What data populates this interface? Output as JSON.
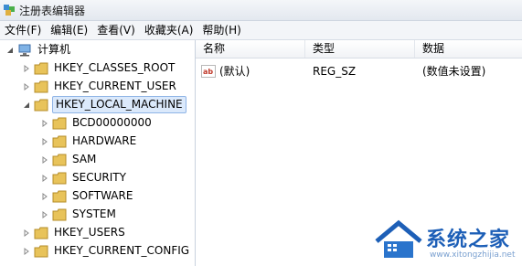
{
  "window": {
    "title": "注册表编辑器"
  },
  "menu": [
    {
      "label": "文件(F)"
    },
    {
      "label": "编辑(E)"
    },
    {
      "label": "查看(V)"
    },
    {
      "label": "收藏夹(A)"
    },
    {
      "label": "帮助(H)"
    }
  ],
  "tree": {
    "root": "计算机",
    "nodes": [
      {
        "label": "HKEY_CLASSES_ROOT",
        "expanded": false
      },
      {
        "label": "HKEY_CURRENT_USER",
        "expanded": false
      },
      {
        "label": "HKEY_LOCAL_MACHINE",
        "expanded": true,
        "selected": true,
        "children": [
          {
            "label": "BCD00000000"
          },
          {
            "label": "HARDWARE"
          },
          {
            "label": "SAM"
          },
          {
            "label": "SECURITY"
          },
          {
            "label": "SOFTWARE"
          },
          {
            "label": "SYSTEM"
          }
        ]
      },
      {
        "label": "HKEY_USERS",
        "expanded": false
      },
      {
        "label": "HKEY_CURRENT_CONFIG",
        "expanded": false
      }
    ]
  },
  "list": {
    "columns": [
      "名称",
      "类型",
      "数据"
    ],
    "rows": [
      {
        "name": "(默认)",
        "type": "REG_SZ",
        "data": "(数值未设置)"
      }
    ]
  },
  "watermark": {
    "text": "系统之家",
    "url": "www.xitongzhijia.net"
  },
  "colors": {
    "selection_bg": "#dbe9fb",
    "folder": "#e8c35a",
    "watermark": "#1d5fb7"
  }
}
